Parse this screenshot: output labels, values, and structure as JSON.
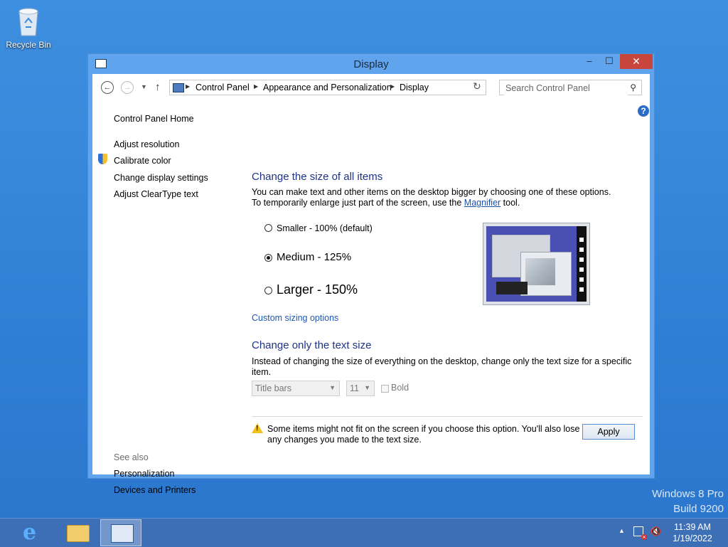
{
  "desktop": {
    "recycle_bin_label": "Recycle Bin",
    "watermark_line1": "Windows 8 Pro",
    "watermark_line2": "Build 9200"
  },
  "window": {
    "title": "Display",
    "buttons": {
      "minimize": "–",
      "maximize": "☐",
      "close": "✕"
    }
  },
  "address_bar": {
    "back": "←",
    "forward": "→",
    "breadcrumbs": [
      "Control Panel",
      "Appearance and Personalization",
      "Display"
    ],
    "search_placeholder": "Search Control Panel"
  },
  "sidebar": {
    "home": "Control Panel Home",
    "links": [
      "Adjust resolution",
      "Calibrate color",
      "Change display settings",
      "Adjust ClearType text"
    ],
    "see_also_title": "See also",
    "see_also": [
      "Personalization",
      "Devices and Printers"
    ]
  },
  "main": {
    "section1_title": "Change the size of all items",
    "section1_text_part1": "You can make text and other items on the desktop bigger by choosing one of these options. To temporarily enlarge just part of the screen, use the ",
    "section1_link": "Magnifier",
    "section1_text_part2": " tool.",
    "options": [
      {
        "label": "Smaller - 100% (default)",
        "selected": false
      },
      {
        "label": "Medium - 125%",
        "selected": true
      },
      {
        "label": "Larger - 150%",
        "selected": false
      }
    ],
    "custom_sizing": "Custom sizing options",
    "section2_title": "Change only the text size",
    "section2_text": "Instead of changing the size of everything on the desktop, change only the text size for a specific item.",
    "item_select": "Title bars",
    "size_select": "11",
    "bold_label": "Bold",
    "bold_checked": false,
    "warning_text": "Some items might not fit on the screen if you choose this option. You'll also lose any changes you made to the text size.",
    "apply": "Apply"
  },
  "taskbar": {
    "time": "11:39 AM",
    "date": "1/19/2022"
  },
  "colors": {
    "heading": "#1e3287",
    "link": "#1e58b3",
    "desktop": "#3f8fe0",
    "close_button": "#c7453a"
  }
}
